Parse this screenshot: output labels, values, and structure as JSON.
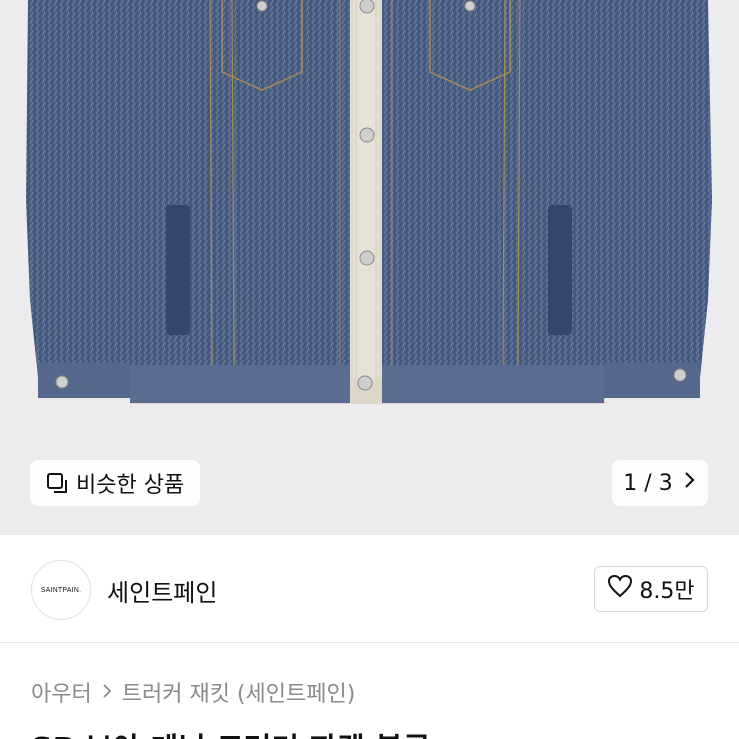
{
  "product_image": {
    "alt_icon": "denim-jacket-image"
  },
  "similar_button": {
    "label": "비슷한 상품",
    "icon": "similar-items-icon"
  },
  "pager": {
    "current": "1",
    "separator": "/",
    "total": "3",
    "icon": "chevron-right-icon"
  },
  "shop": {
    "logo_text": "SAINTPAIN.",
    "name": "세인트페인"
  },
  "like": {
    "count": "8.5만",
    "icon": "heart-icon"
  },
  "breadcrumb": {
    "items": [
      "아우터",
      "트러커 재킷 (세인트페인)"
    ]
  },
  "product": {
    "title": "SP 보아 데님 트러커 자켓 블루"
  },
  "colors": {
    "denim": "#4a5d7f",
    "background": "#ececee",
    "text": "#111111",
    "muted": "#8a8a8a"
  }
}
